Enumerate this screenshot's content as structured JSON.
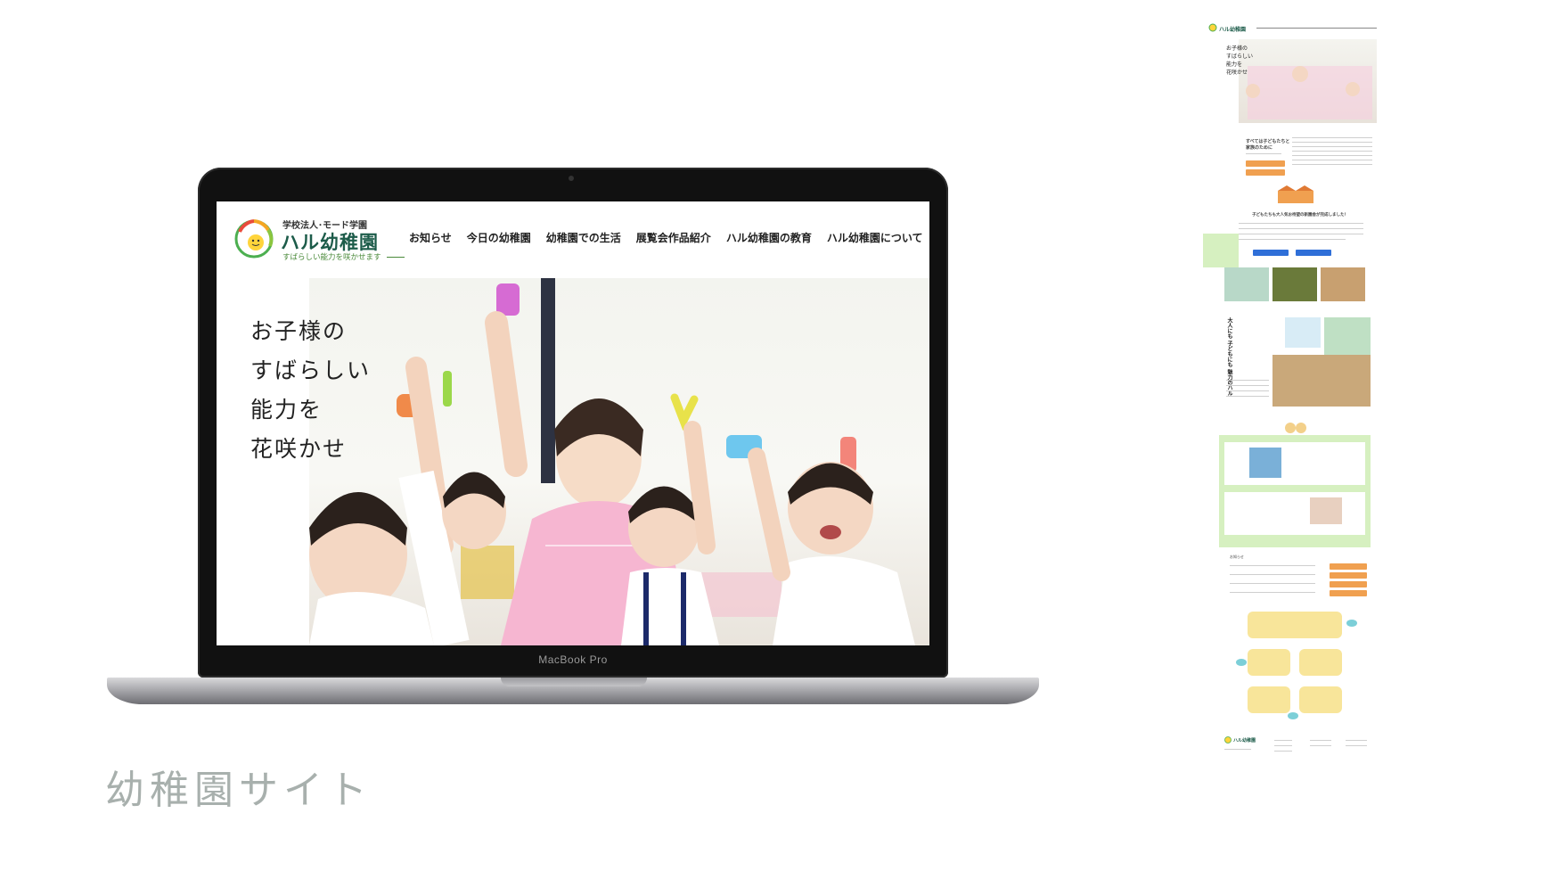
{
  "laptop": {
    "brand": "MacBook Pro"
  },
  "site": {
    "logo": {
      "subtitle": "学校法人･モード学園",
      "name": "ハル幼稚園",
      "tagline": "すばらしい能力を咲かせます"
    },
    "nav": [
      "お知らせ",
      "今日の幼稚園",
      "幼稚園での生活",
      "展覧会作品紹介",
      "ハル幼稚園の教育",
      "ハル幼稚園について"
    ],
    "hero_copy": [
      "お子様の",
      "すばらしい",
      "能力を",
      "花咲かせ"
    ]
  },
  "caption": "幼稚園サイト",
  "thumbnail": {
    "logo_name": "ハル幼稚園",
    "hero_copy": [
      "お子様の",
      "すばらしい",
      "能力を",
      "花咲かせ"
    ],
    "intro_heading": [
      "すべては子どもたちと",
      "家族のために"
    ],
    "section_heading": "子どもたちも大人気お待望の新園舎が完成しました！",
    "vertical_heading": [
      "大人にも",
      "子どもにも",
      "魅力のハル"
    ],
    "news_label": "お知らせ",
    "footer_logo": "ハル幼稚園"
  },
  "colors": {
    "nav_text": "#222222",
    "logo_green": "#1d5c4a",
    "caption_gray": "#a8b0ad",
    "thumb_orange": "#f0a050",
    "thumb_blue": "#2f6fd8",
    "thumb_green": "#d6f0c0",
    "thumb_yellow": "#f8e59a"
  }
}
